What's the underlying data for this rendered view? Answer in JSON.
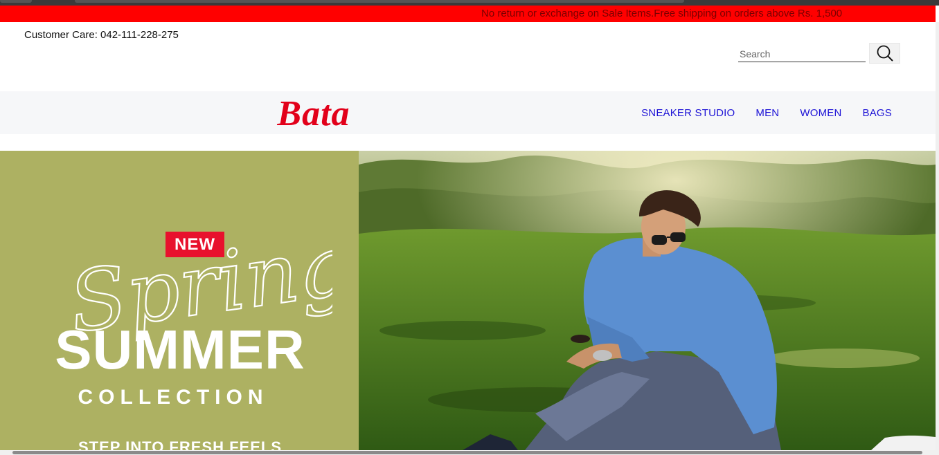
{
  "promo": {
    "text": "No return or exchange on Sale Items.Free shipping on orders above Rs. 1,500"
  },
  "header": {
    "customer_care": "Customer Care: 042-111-228-275",
    "search_placeholder": "Search"
  },
  "logo": {
    "text": "Bata",
    "color": "#e2001a"
  },
  "nav": {
    "items": [
      {
        "label": "SNEAKER STUDIO"
      },
      {
        "label": "MEN"
      },
      {
        "label": "WOMEN"
      },
      {
        "label": "BAGS"
      }
    ],
    "color": "#1c12d6"
  },
  "hero": {
    "badge": "NEW",
    "script_word": "Spring",
    "headline": "SUMMER",
    "subheadline": "COLLECTION",
    "tagline": "STEP INTO FRESH FEELS",
    "panel_color": "#adb162"
  },
  "icons": {
    "search": "search-icon"
  }
}
